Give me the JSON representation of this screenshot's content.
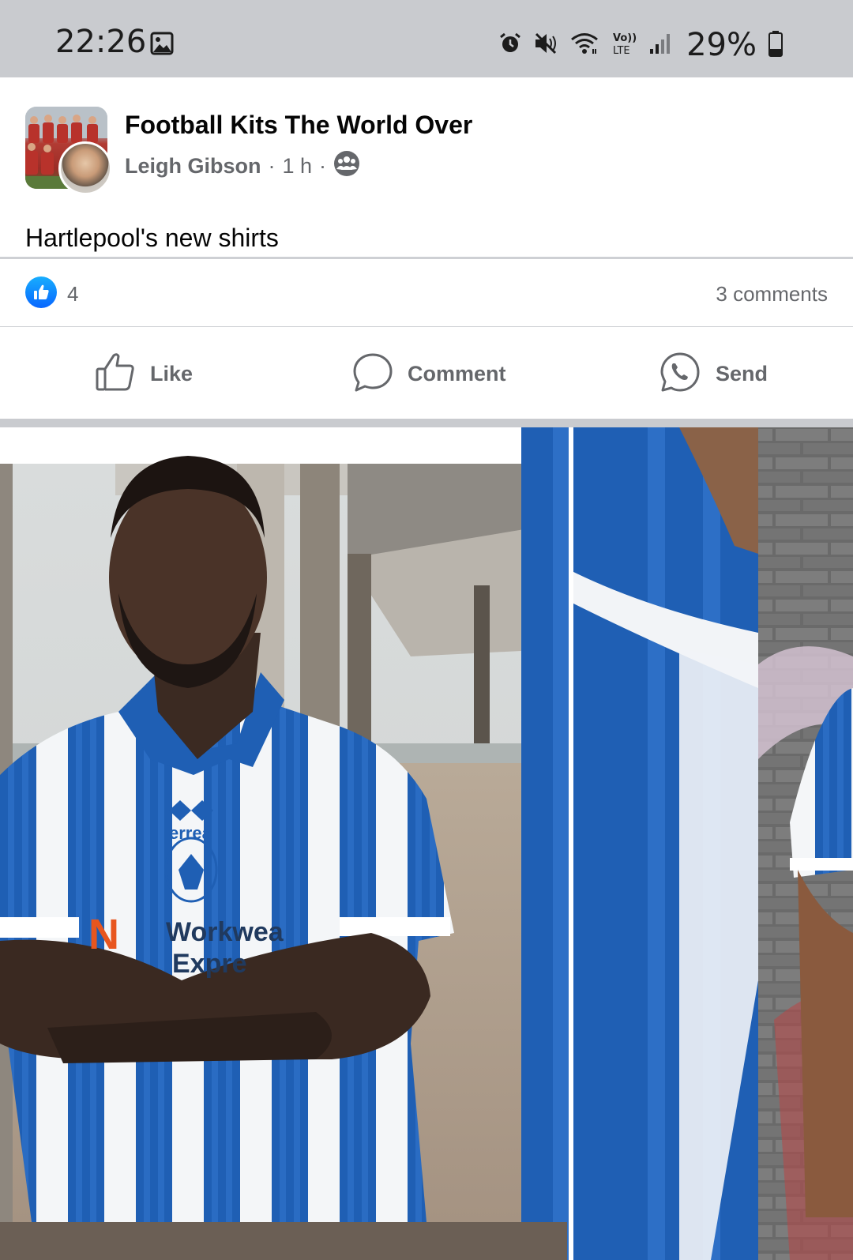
{
  "status_bar": {
    "time": "22:26",
    "battery": "29%",
    "icons": [
      "gallery-icon",
      "alarm-icon",
      "mute-icon",
      "wifi-icon",
      "volte-icon",
      "signal-icon",
      "battery-icon"
    ]
  },
  "post": {
    "group_name": "Football Kits The World Over",
    "author": "Leigh Gibson",
    "time_ago": "1 h",
    "audience_icon": "group-audience-icon",
    "text": "Hartlepool's new shirts",
    "reaction_count": "4",
    "comment_count": "3 comments"
  },
  "actions": {
    "like": "Like",
    "comment": "Comment",
    "send": "Send"
  },
  "photo": {
    "jersey_brand": "errea",
    "sponsor_line1": "Workwea",
    "sponsor_line2": "Expre"
  },
  "colors": {
    "like_blue": "#0866ff",
    "stripe_blue": "#1f5fb4",
    "secondary_text": "#65676b"
  }
}
